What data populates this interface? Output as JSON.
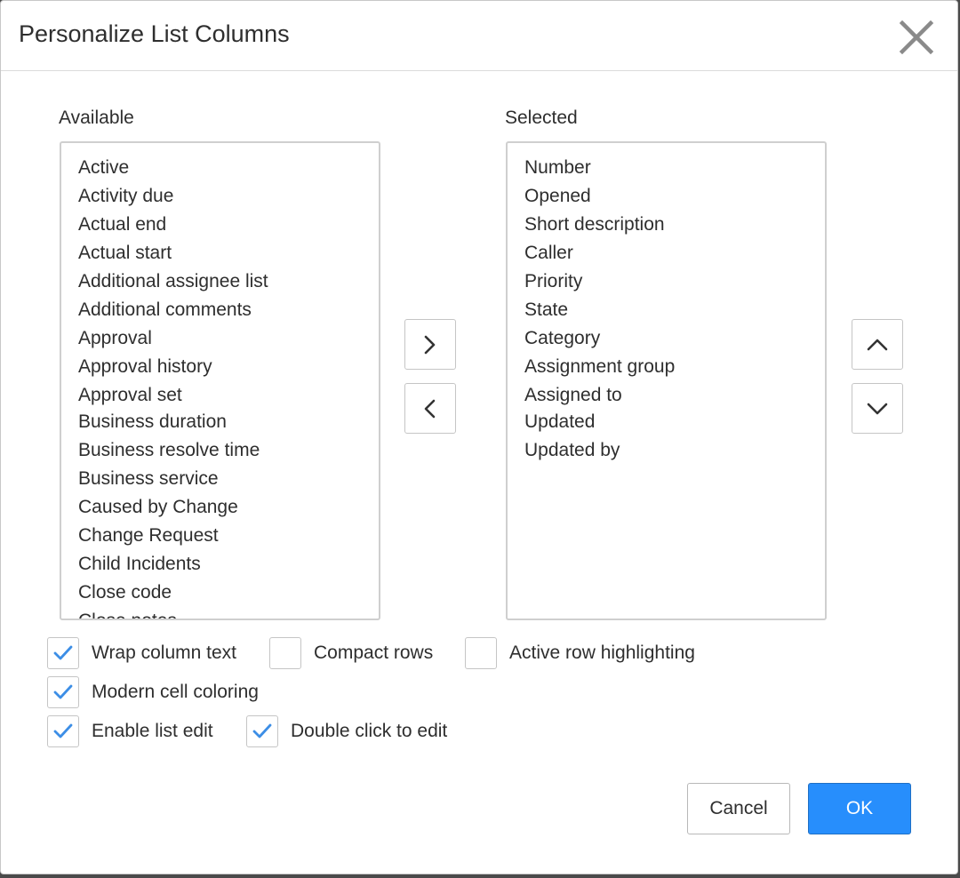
{
  "dialog": {
    "title": "Personalize List Columns",
    "close_icon": "close-icon"
  },
  "available": {
    "label": "Available",
    "items": [
      "Active",
      "Activity due",
      "Actual end",
      "Actual start",
      "Additional assignee list",
      "Additional comments",
      "Approval",
      "Approval history",
      "Approval set",
      "Business duration",
      "Business resolve time",
      "Business service",
      "Caused by Change",
      "Change Request",
      "Child Incidents",
      "Close code",
      "Close notes"
    ]
  },
  "selected": {
    "label": "Selected",
    "items": [
      "Number",
      "Opened",
      "Short description",
      "Caller",
      "Priority",
      "State",
      "Category",
      "Assignment group",
      "Assigned to",
      "Updated",
      "Updated by"
    ]
  },
  "transfer": {
    "add_icon": "chevron-right-icon",
    "remove_icon": "chevron-left-icon",
    "move_up_icon": "chevron-up-icon",
    "move_down_icon": "chevron-down-icon"
  },
  "options": {
    "wrap_column_text": {
      "label": "Wrap column text",
      "checked": true
    },
    "compact_rows": {
      "label": "Compact rows",
      "checked": false
    },
    "active_row_highlighting": {
      "label": "Active row highlighting",
      "checked": false
    },
    "modern_cell_coloring": {
      "label": "Modern cell coloring",
      "checked": true
    },
    "enable_list_edit": {
      "label": "Enable list edit",
      "checked": true
    },
    "double_click_to_edit": {
      "label": "Double click to edit",
      "checked": true
    }
  },
  "footer": {
    "cancel_label": "Cancel",
    "ok_label": "OK"
  },
  "colors": {
    "accent": "#278efc",
    "check": "#3c8ee6",
    "border": "#c5c5c5"
  }
}
